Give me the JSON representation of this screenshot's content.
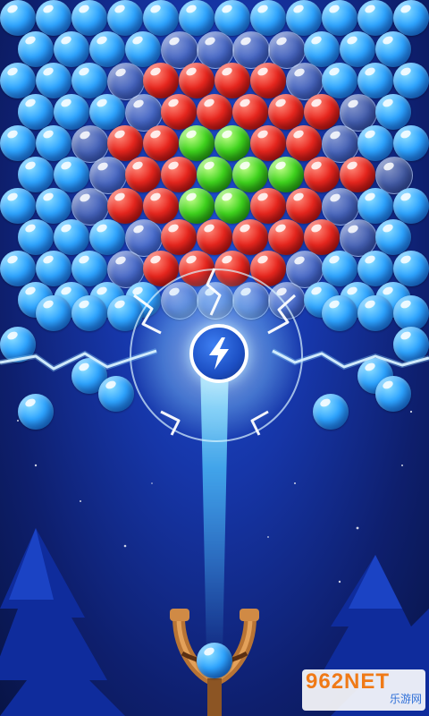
{
  "game": {
    "accent_blue": "#2ea4ff",
    "accent_red": "#e8261e",
    "accent_green": "#3fd41e",
    "power_icon": "lightning-icon"
  },
  "grid": {
    "rows": [
      "bbbbbbbbbbbb",
      "bbbbccccbbbb",
      "bbbcrrrrcbbb",
      "bbbcrrrrrcbb",
      "bbcrrggrrcbb",
      "bbcrrgggrrcb",
      "bbcrrggrrcbb",
      "bbbcrrrrrcbb",
      "bbbcrrrrcbbb",
      "bbbbccccbbbb"
    ],
    "shooter_color": "blue"
  },
  "watermark": {
    "brand": "962NET",
    "sub": "乐游网"
  }
}
